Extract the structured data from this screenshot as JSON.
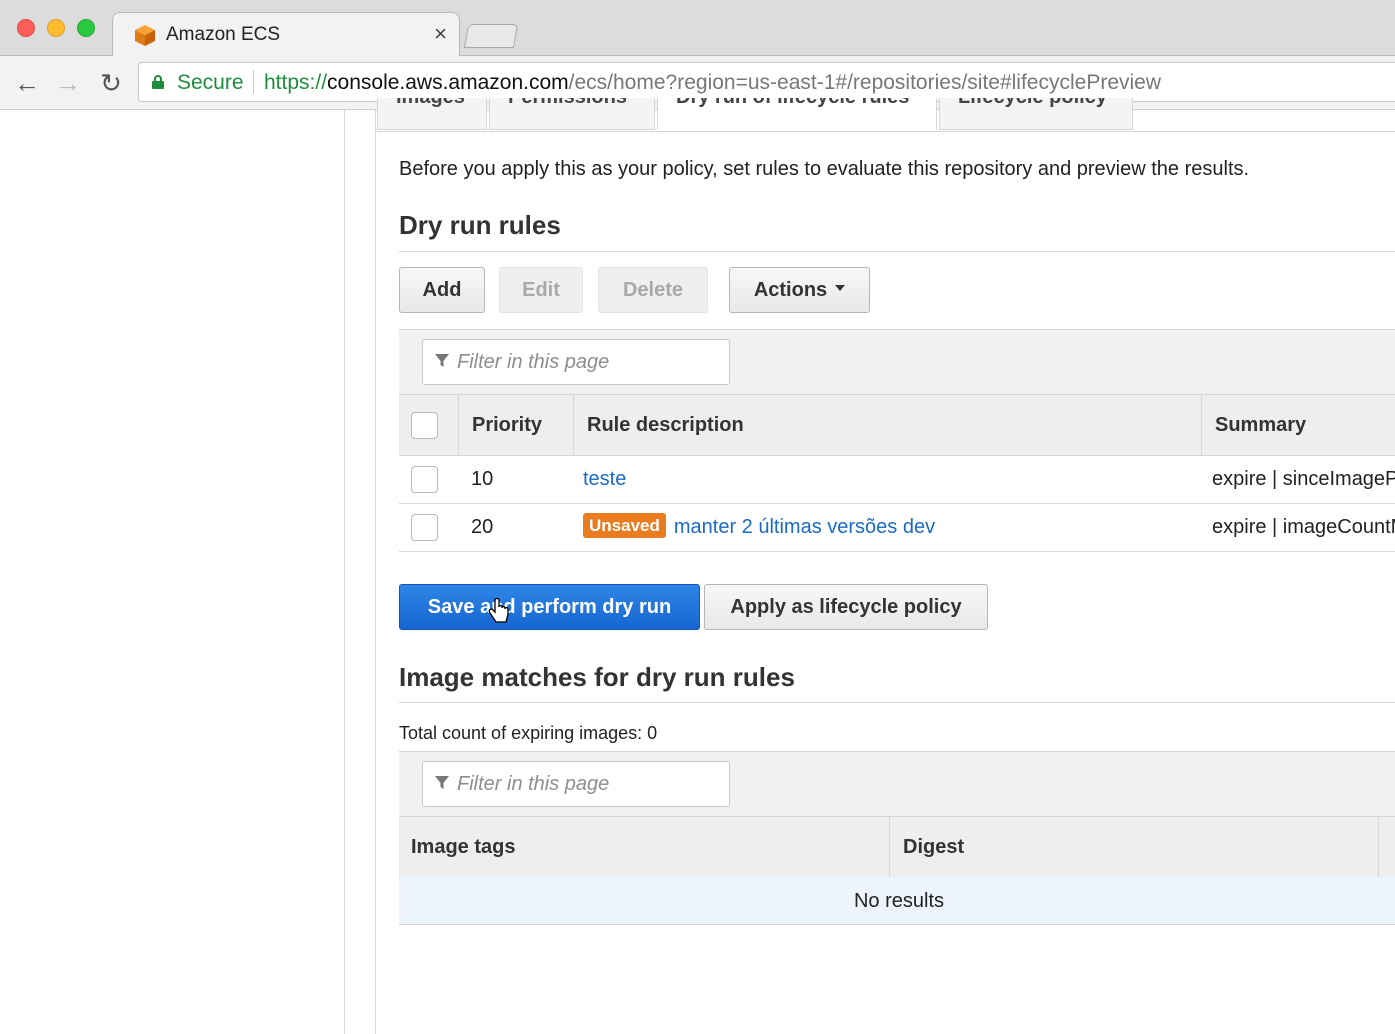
{
  "browser": {
    "tab_title": "Amazon ECS",
    "secure_label": "Secure",
    "url_scheme": "https://",
    "url_host": "console.aws.amazon.com",
    "url_path": "/ecs/home?region=us-east-1#/repositories/site#lifecyclePreview"
  },
  "repo_tabs": [
    "Images",
    "Permissions",
    "Dry run of lifecycle rules",
    "Lifecycle policy"
  ],
  "intro": "Before you apply this as your policy, set rules to evaluate this repository and preview the results.",
  "dry_run": {
    "title": "Dry run rules",
    "buttons": {
      "add": "Add",
      "edit": "Edit",
      "delete": "Delete",
      "actions": "Actions"
    },
    "filter_placeholder": "Filter in this page",
    "columns": {
      "priority": "Priority",
      "rule_description": "Rule description",
      "summary": "Summary"
    },
    "rows": [
      {
        "priority": "10",
        "badge": "",
        "description": "teste",
        "summary": "expire | sinceImagePushed"
      },
      {
        "priority": "20",
        "badge": "Unsaved",
        "description": "manter 2 últimas versões dev",
        "summary": "expire | imageCountMoreThan"
      }
    ]
  },
  "actions": {
    "save_dry_run": "Save and perform dry run",
    "apply_policy": "Apply as lifecycle policy"
  },
  "matches": {
    "title": "Image matches for dry run rules",
    "total_count": "Total count of expiring images: 0",
    "filter_placeholder": "Filter in this page",
    "columns": {
      "image_tags": "Image tags",
      "digest": "Digest"
    },
    "empty": "No results"
  },
  "colors": {
    "primary_button": "#1766d0",
    "link": "#1a6bc5",
    "unsaved_badge": "#e87c1e",
    "secure": "#1e8e3e"
  }
}
